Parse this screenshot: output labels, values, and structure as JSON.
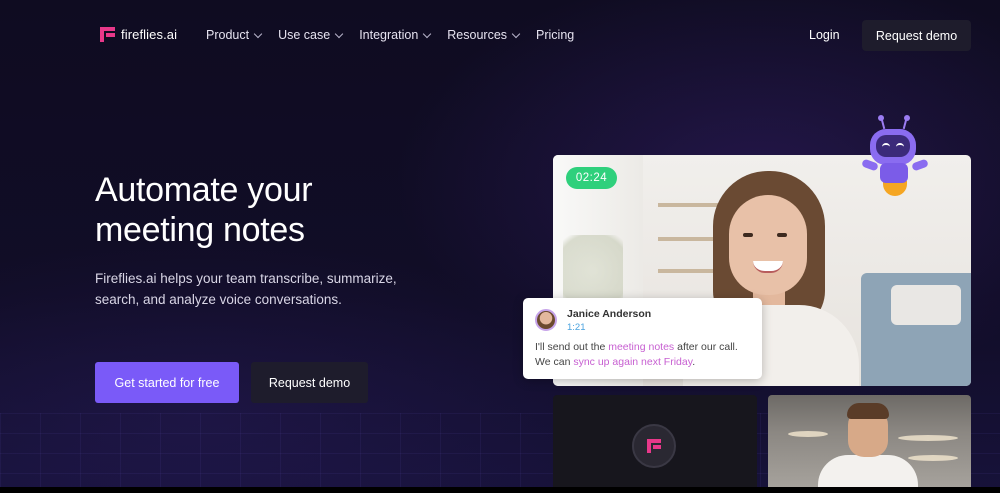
{
  "brand": {
    "name": "fireflies.ai",
    "accent": "#e8388a",
    "primary": "#7a5af8"
  },
  "nav": {
    "items": [
      {
        "label": "Product",
        "dropdown": true
      },
      {
        "label": "Use case",
        "dropdown": true
      },
      {
        "label": "Integration",
        "dropdown": true
      },
      {
        "label": "Resources",
        "dropdown": true
      },
      {
        "label": "Pricing",
        "dropdown": false
      }
    ],
    "login": "Login",
    "request_demo": "Request demo"
  },
  "hero": {
    "headline_line1": "Automate your",
    "headline_line2": "meeting notes",
    "subtext": "Fireflies.ai helps your team transcribe, summarize, search, and analyze voice conversations.",
    "cta_primary": "Get started for free",
    "cta_secondary": "Request demo"
  },
  "call": {
    "timer": "02:24",
    "chat": {
      "name": "Janice Anderson",
      "time": "1:21",
      "line1_pre": "I'll send out the ",
      "line1_hl": "meeting notes",
      "line1_post": " after our call.",
      "line2_pre": "We can ",
      "line2_hl": "sync up again next Friday",
      "line2_post": "."
    }
  },
  "icons": {
    "logo": "fireflies-logo-icon",
    "robot": "robot-mascot-icon",
    "chevron": "chevron-down-icon"
  }
}
